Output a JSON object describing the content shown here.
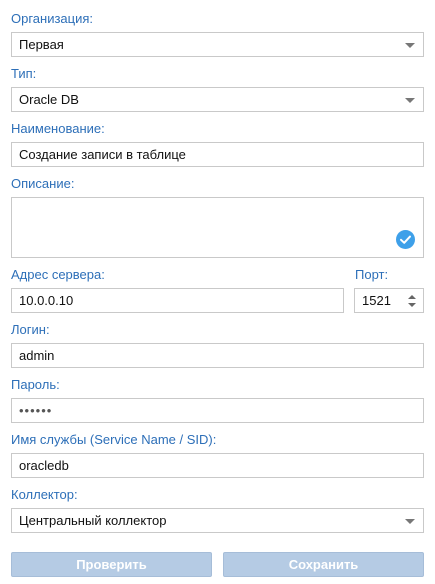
{
  "organization": {
    "label": "Организация:",
    "value": "Первая"
  },
  "type": {
    "label": "Тип:",
    "value": "Oracle DB"
  },
  "name": {
    "label": "Наименование:",
    "value": "Создание записи в таблице"
  },
  "description": {
    "label": "Описание:",
    "value": ""
  },
  "server": {
    "label": "Адрес сервера:",
    "value": "10.0.0.10"
  },
  "port": {
    "label": "Порт:",
    "value": "1521"
  },
  "login": {
    "label": "Логин:",
    "value": "admin"
  },
  "password": {
    "label": "Пароль:",
    "value": "••••••"
  },
  "service": {
    "label": "Имя службы (Service Name / SID):",
    "value": "oracledb"
  },
  "collector": {
    "label": "Коллектор:",
    "value": "Центральный коллектор"
  },
  "buttons": {
    "check": "Проверить",
    "save": "Сохранить"
  },
  "colors": {
    "label": "#2d6fb8",
    "button_bg": "#b5cbe4",
    "check_icon": "#3ea0e9"
  }
}
